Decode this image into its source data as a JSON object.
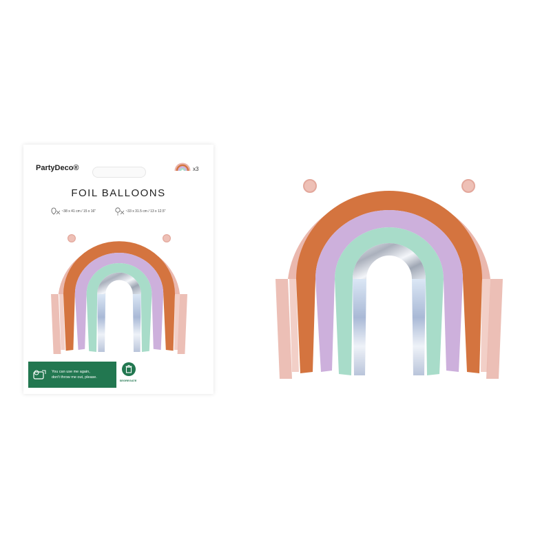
{
  "package": {
    "brand": "PartyDeco®",
    "title": "FOIL BALLOONS",
    "count": "x3",
    "spec_inflated": "~38 x 41 cm / 15 x 16\"",
    "spec_deflated": "~33 x 31.5 cm / 13 x 12.5\"",
    "eco_line1": "You can use me again,",
    "eco_line2": "don't throw me out, please.",
    "recycle_label": "SEGREGATE"
  },
  "colors": {
    "orange": "#d4743f",
    "lilac": "#cdb0dc",
    "mint": "#a8dcc9",
    "silver": "#c8cdd6",
    "pink": "#e9b3aa",
    "eco_green": "#227750"
  },
  "icons": [
    "rainbow-balloon-icon",
    "helium-balloon-icon",
    "air-balloon-icon",
    "reuse-icon",
    "recycle-bin-icon"
  ]
}
